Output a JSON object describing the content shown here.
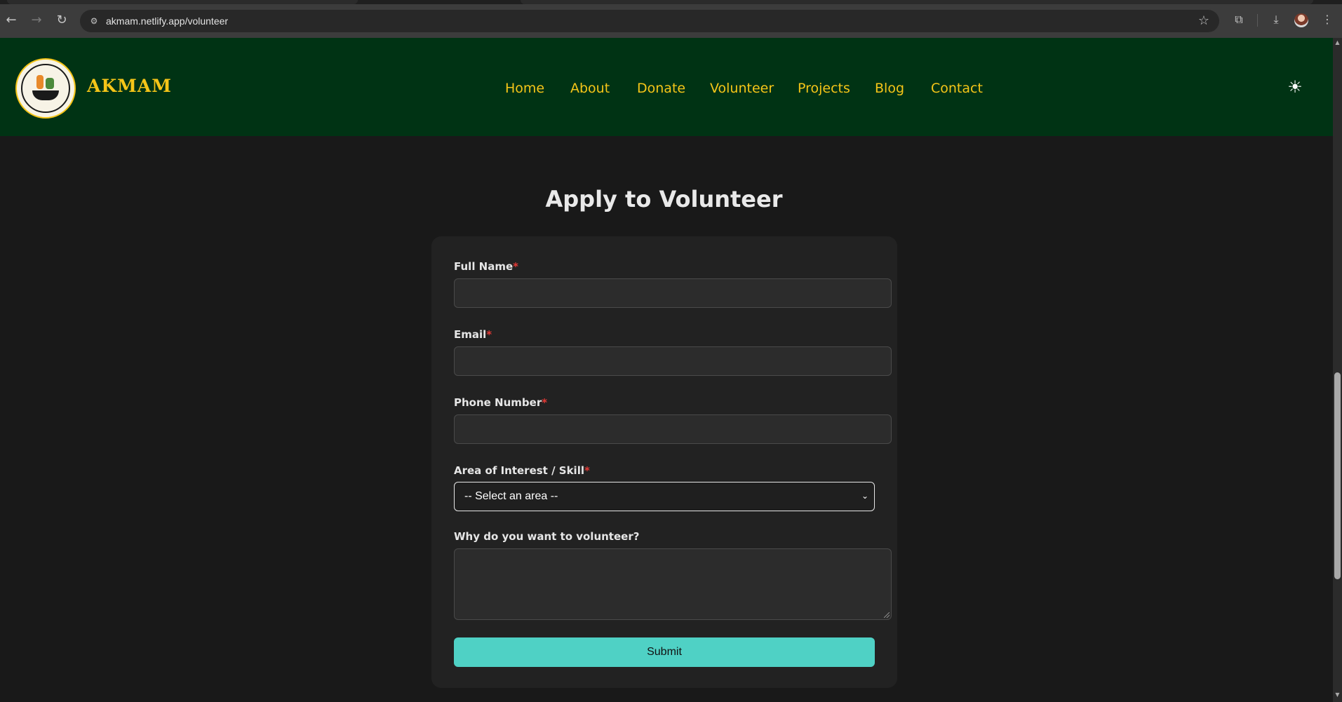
{
  "browser": {
    "url": "akmam.netlify.app/volunteer",
    "icons": [
      "back-icon",
      "forward-icon",
      "reload-icon",
      "site-info-icon",
      "bookmark-star-icon",
      "extensions-icon",
      "download-icon",
      "profile-avatar",
      "menu-dots-icon"
    ]
  },
  "header": {
    "brand": "AKMAM",
    "nav": [
      "Home",
      "About",
      "Donate",
      "Volunteer",
      "Projects",
      "Blog",
      "Contact"
    ],
    "theme_icon": "sun-icon"
  },
  "main": {
    "title": "Apply to Volunteer",
    "form": {
      "full_name_label": "Full Name",
      "email_label": "Email",
      "phone_label": "Phone Number",
      "area_label": "Area of Interest / Skill",
      "area_selected": "-- Select an area --",
      "why_label": "Why do you want to volunteer?",
      "required_mark": "*",
      "submit_label": "Submit"
    }
  },
  "colors": {
    "header_bg": "#003314",
    "accent_gold": "#f5c518",
    "submit_bg": "#4fd1c5",
    "page_bg": "#191919",
    "required": "#e53935"
  }
}
